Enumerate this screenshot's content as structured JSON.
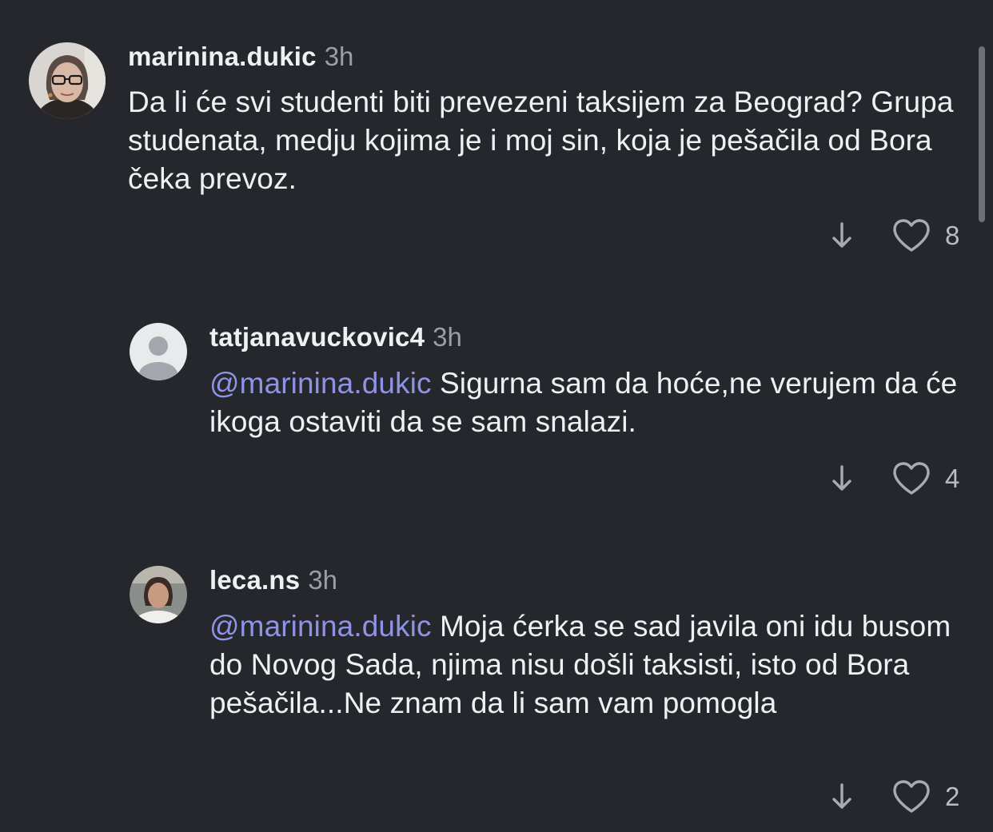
{
  "comments": [
    {
      "username": "marinina.dukic",
      "time": "3h",
      "mention": "",
      "text": "Da li će svi studenti biti prevezeni taksijem za Beograd? Grupa studenata, medju kojima je i moj sin, koja je pešačila od Bora čeka prevoz.",
      "likes": "8",
      "avatar": "woman-glasses-avatar"
    },
    {
      "username": "tatjanavuckovic4",
      "time": "3h",
      "mention": "@marinina.dukic",
      "text": " Sigurna sam da hoće,ne verujem da će ikoga ostaviti da se sam snalazi.",
      "likes": "4",
      "avatar": "default-user-avatar"
    },
    {
      "username": "leca.ns",
      "time": "3h",
      "mention": "@marinina.dukic",
      "text": " Moja ćerka se sad javila oni idu busom do Novog Sada, njima nisu došli taksisti, isto od Bora pešačila...Ne znam da li sam vam pomogla",
      "likes": "2",
      "avatar": "woman-photo-avatar"
    }
  ],
  "icons": {
    "reply": "arrow-down-icon",
    "like": "heart-outline-icon"
  },
  "colors": {
    "background": "#25272c",
    "text": "#eef0f3",
    "secondary": "#9b9ea6",
    "mention": "#8f93e6"
  }
}
